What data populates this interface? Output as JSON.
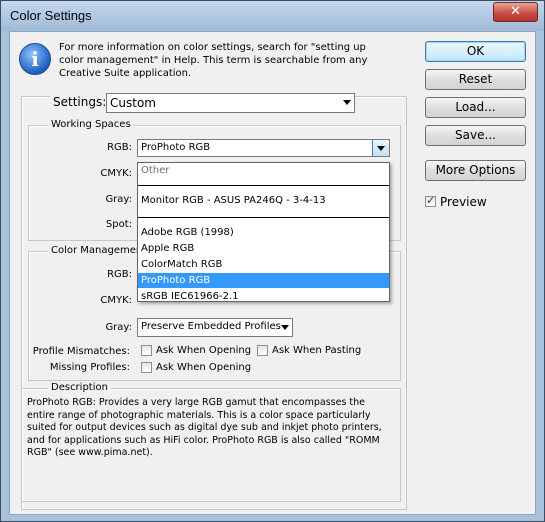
{
  "window": {
    "title": "Color Settings",
    "close_glyph": "✕"
  },
  "info": {
    "icon": "info-icon",
    "icon_glyph": "i",
    "lines": [
      "For more information on color settings, search for \"setting up",
      "color management\" in Help. This term is searchable from any",
      "Creative Suite application."
    ]
  },
  "settings": {
    "label": "Settings:",
    "value": "Custom"
  },
  "working_spaces": {
    "title": "Working Spaces",
    "rgb_label": "RGB:",
    "rgb_value": "ProPhoto RGB",
    "cmyk_label": "CMYK:",
    "gray_label": "Gray:",
    "spot_label": "Spot:"
  },
  "rgb_dropdown": {
    "items": [
      {
        "label": "Other",
        "state": "disabled"
      },
      {
        "label": "Monitor RGB - ASUS PA246Q - 3-4-13",
        "state": "normal"
      },
      {
        "label": "Adobe RGB (1998)",
        "state": "normal"
      },
      {
        "label": "Apple RGB",
        "state": "normal"
      },
      {
        "label": "ColorMatch RGB",
        "state": "normal"
      },
      {
        "label": "ProPhoto RGB",
        "state": "selected"
      },
      {
        "label": "sRGB IEC61966-2.1",
        "state": "normal"
      }
    ]
  },
  "color_management": {
    "title": "Color Management",
    "rgb_label": "RGB:",
    "cmyk_label": "CMYK:",
    "gray_label": "Gray:",
    "gray_value": "Preserve Embedded Profiles",
    "mismatch_label": "Profile Mismatches:",
    "ask_opening": "Ask When Opening",
    "ask_pasting": "Ask When Pasting",
    "missing_label": "Missing Profiles:",
    "ask_opening_missing": "Ask When Opening"
  },
  "description": {
    "title": "Description",
    "lines": [
      "ProPhoto RGB:  Provides a very large RGB gamut that encompasses the",
      "entire range of photographic materials. This is a color space particularly",
      "suited for output devices such as digital dye sub and inkjet photo printers,",
      "and for applications such as HiFi color. ProPhoto RGB is also called \"ROMM",
      "RGB\" (see www.pima.net)."
    ]
  },
  "buttons": {
    "ok": "OK",
    "reset": "Reset",
    "load": "Load...",
    "save": "Save...",
    "more_options": "More Options",
    "preview": "Preview",
    "preview_checked": true
  },
  "colors": {
    "titlebar": "#a8c2dc",
    "selection": "#3399ff",
    "close_button": "#c75049"
  }
}
